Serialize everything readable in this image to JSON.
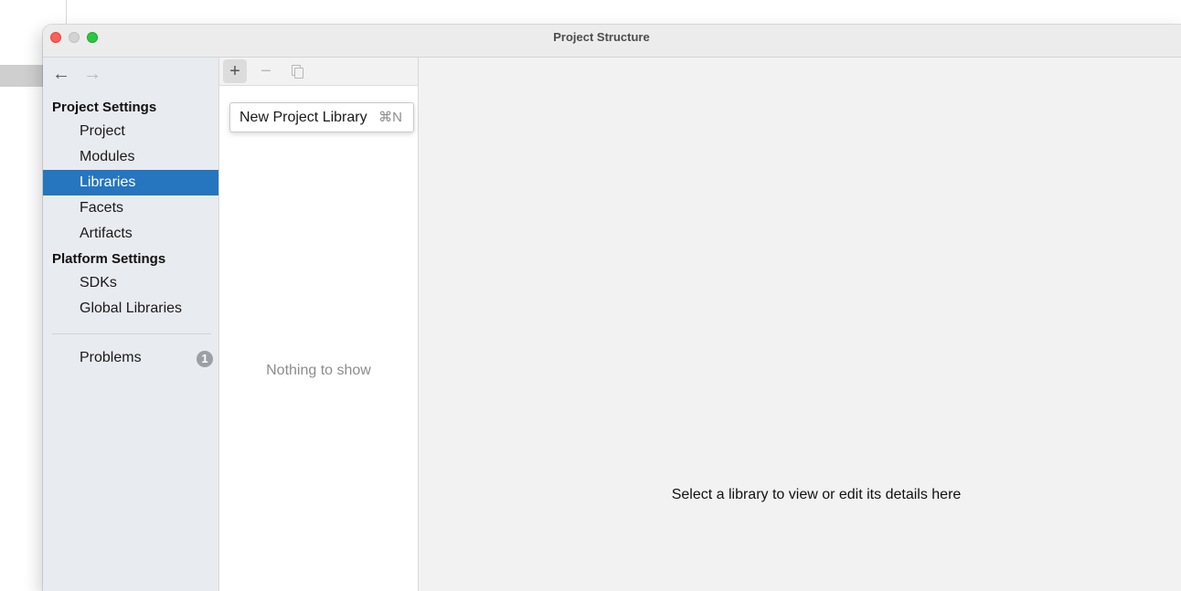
{
  "window": {
    "title": "Project Structure"
  },
  "nav": {
    "back_icon": "←",
    "forward_icon": "→"
  },
  "sidebar": {
    "project_settings_header": "Project Settings",
    "project_items": [
      "Project",
      "Modules",
      "Libraries",
      "Facets",
      "Artifacts"
    ],
    "selected_item": "Libraries",
    "platform_settings_header": "Platform Settings",
    "platform_items": [
      "SDKs",
      "Global Libraries"
    ],
    "problems_label": "Problems",
    "problems_count": "1"
  },
  "toolbar": {
    "add_icon": "+",
    "remove_icon": "−"
  },
  "popup": {
    "label": "New Project Library",
    "shortcut": "⌘N"
  },
  "libraries": {
    "empty_text": "Nothing to show"
  },
  "detail": {
    "placeholder": "Select a library to view or edit its details here"
  },
  "colors": {
    "selection": "#2675bf",
    "close": "#ff5f57",
    "maximize": "#28c840"
  }
}
